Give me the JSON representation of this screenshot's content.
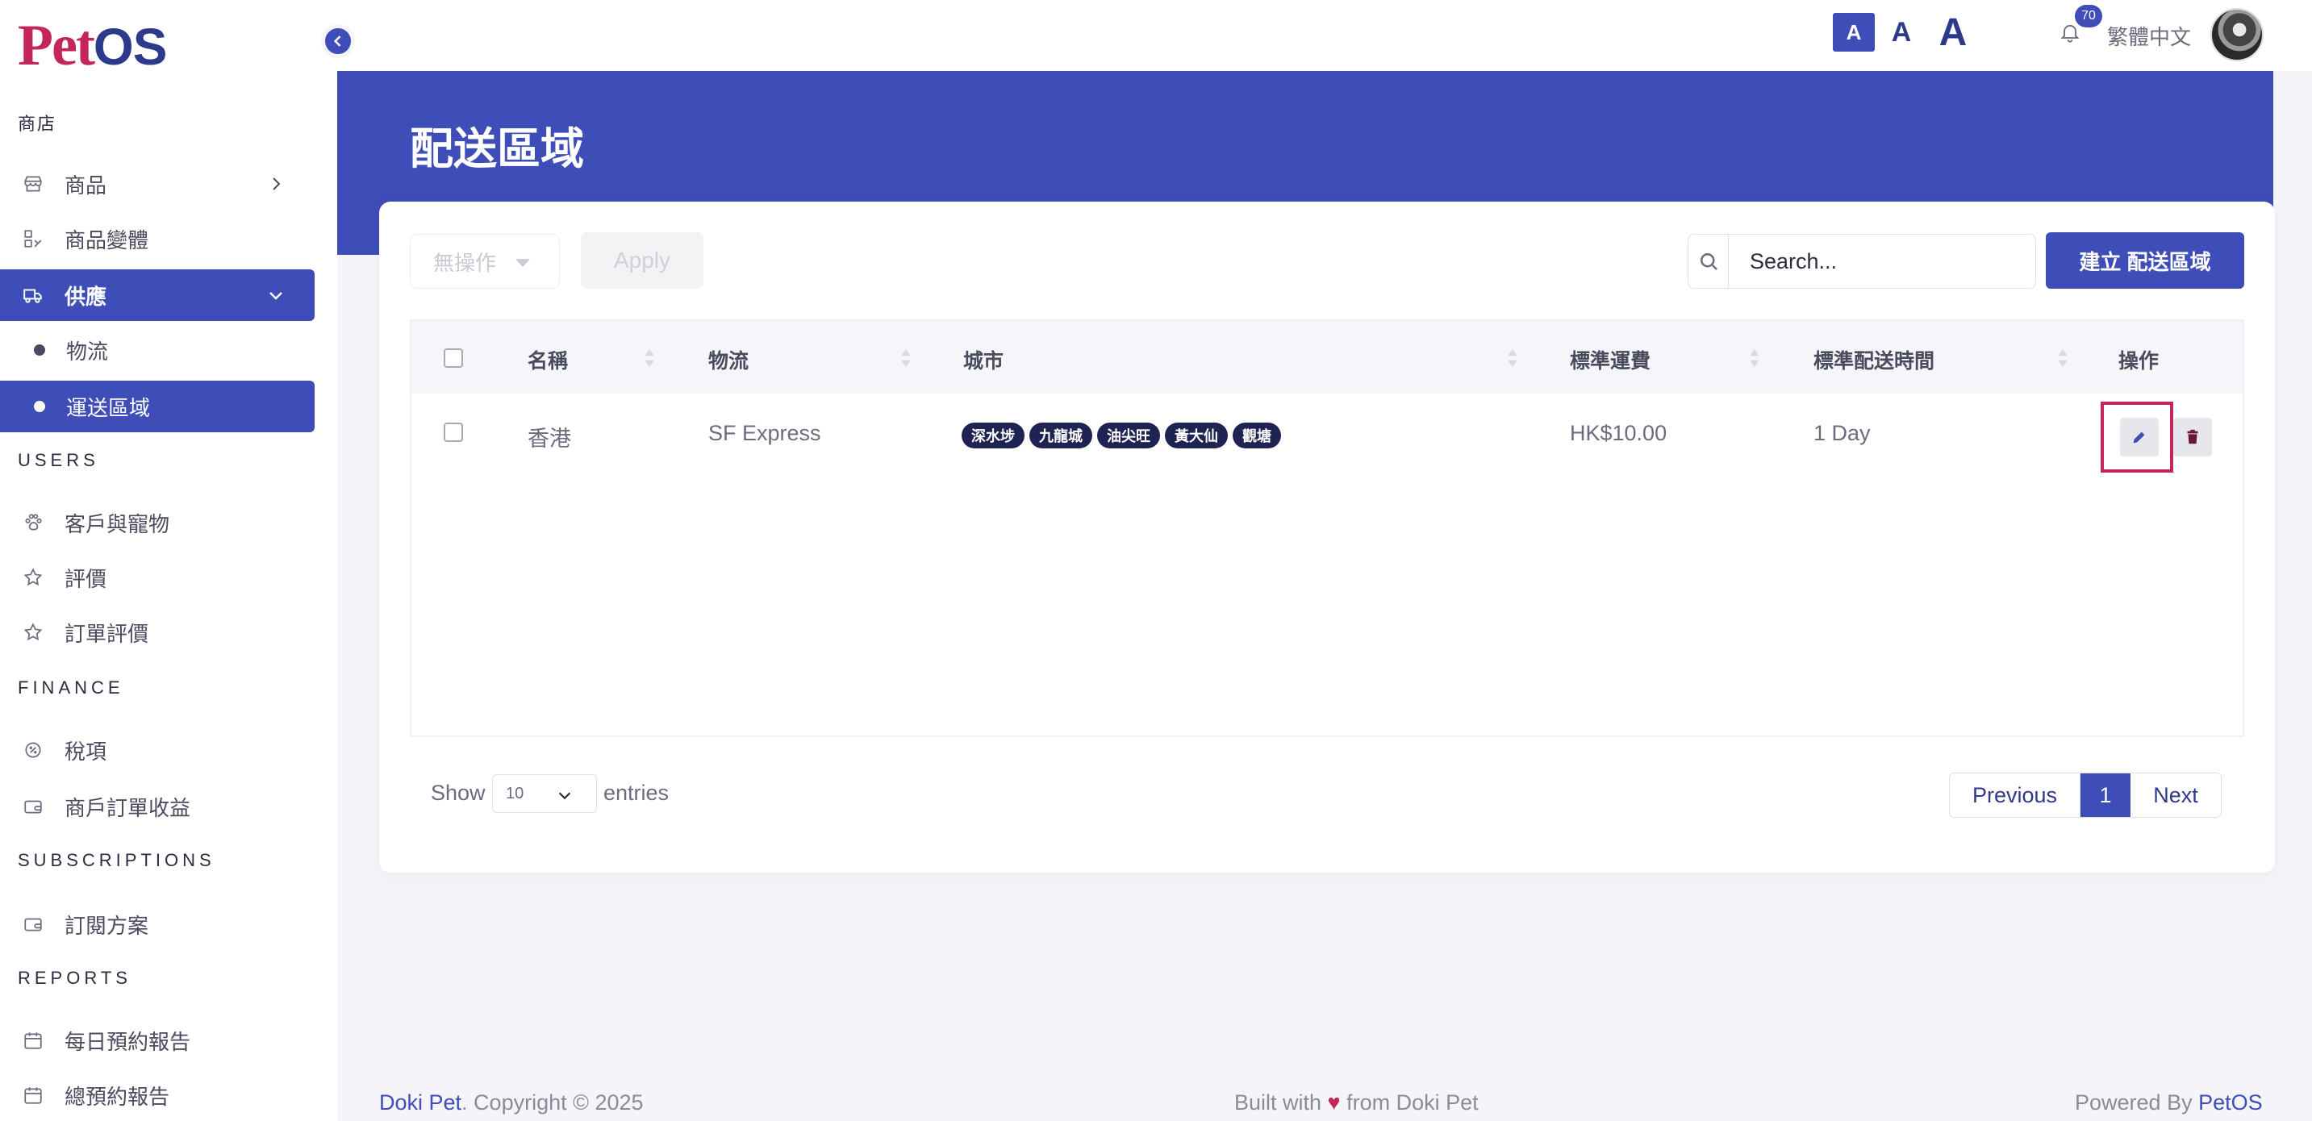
{
  "brand": {
    "logo_pet": "Pet",
    "logo_os": "OS"
  },
  "sidebar": {
    "sections": {
      "shop": "商店",
      "users": "USERS",
      "finance": "FINANCE",
      "subscriptions": "SUBSCRIPTIONS",
      "reports": "REPORTS"
    },
    "items": {
      "products": "商品",
      "variants": "商品變體",
      "supply": "供應",
      "logistics": "物流",
      "shipping_zones": "運送區域",
      "customers_pets": "客戶與寵物",
      "reviews": "評價",
      "order_reviews": "訂單評價",
      "tax": "稅項",
      "merchant_revenue": "商戶訂單收益",
      "subscription_plans": "訂閱方案",
      "daily_booking_report": "每日預約報告",
      "total_booking_report": "總預約報告"
    }
  },
  "topbar": {
    "font_small": "A",
    "font_medium": "A",
    "font_large": "A",
    "notification_count": "70",
    "language": "繁體中文"
  },
  "page": {
    "title": "配送區域"
  },
  "toolbar": {
    "bulk_action": "無操作",
    "apply": "Apply",
    "search_placeholder": "Search...",
    "create": "建立 配送區域"
  },
  "table": {
    "headers": {
      "name": "名稱",
      "logistics": "物流",
      "city": "城市",
      "standard_fee": "標準運費",
      "standard_time": "標準配送時間",
      "actions": "操作"
    },
    "rows": [
      {
        "name": "香港",
        "logistics": "SF Express",
        "cities": [
          "深水埗",
          "九龍城",
          "油尖旺",
          "黃大仙",
          "觀塘"
        ],
        "fee": "HK$10.00",
        "time": "1 Day"
      }
    ]
  },
  "pagination": {
    "show": "Show",
    "page_size": "10",
    "entries": "entries",
    "previous": "Previous",
    "current": "1",
    "next": "Next"
  },
  "footer": {
    "left_brand": "Doki Pet",
    "left_text": ". Copyright © 2025",
    "mid_prefix": "Built with ",
    "heart": "♥",
    "mid_suffix": " from Doki Pet",
    "right_prefix": "Powered By ",
    "right_brand": "PetOS"
  },
  "colors": {
    "primary": "#3f4db8",
    "accent": "#c4265b",
    "tag": "#1f2352"
  }
}
